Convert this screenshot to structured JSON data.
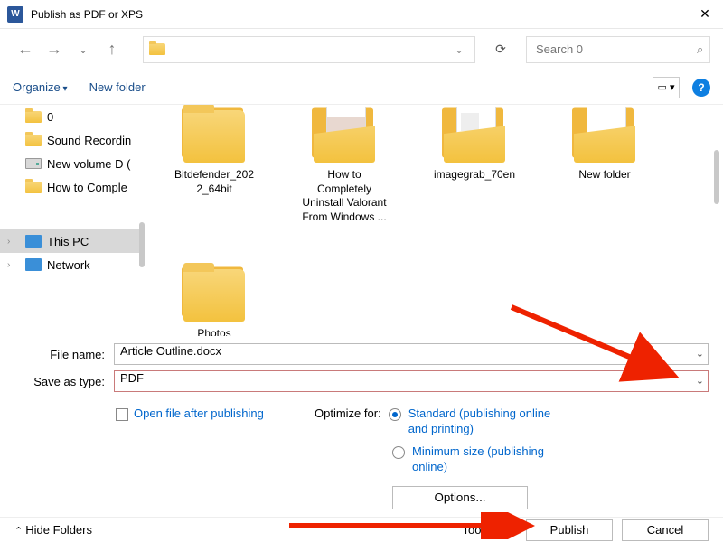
{
  "title": "Publish as PDF or XPS",
  "search": {
    "placeholder": "Search 0"
  },
  "toolbar": {
    "organize": "Organize",
    "new_folder": "New folder"
  },
  "sidebar": {
    "items": [
      {
        "label": "0",
        "icon": "folder"
      },
      {
        "label": "Sound Recordin",
        "icon": "folder"
      },
      {
        "label": "New volume D (",
        "icon": "drive"
      },
      {
        "label": "How to Comple",
        "icon": "folder"
      }
    ],
    "roots": [
      {
        "label": "This PC",
        "icon": "pc",
        "selected": true
      },
      {
        "label": "Network",
        "icon": "net",
        "selected": false
      }
    ]
  },
  "folders": [
    {
      "label": "Bitdefender_2022_64bit",
      "preview": "none"
    },
    {
      "label": "How to Completely Uninstall Valorant From Windows ...",
      "preview": "p1"
    },
    {
      "label": "imagegrab_70en",
      "preview": "p2"
    },
    {
      "label": "New folder",
      "preview": "p3"
    },
    {
      "label": "Photos",
      "preview": "none"
    }
  ],
  "form": {
    "filename_label": "File name:",
    "filename_value": "Article Outline.docx",
    "type_label": "Save as type:",
    "type_value": "PDF",
    "open_after": "Open file after publishing",
    "optimize_label": "Optimize for:",
    "opt_standard": "Standard (publishing online and printing)",
    "opt_minimum": "Minimum size (publishing online)",
    "options_btn": "Options..."
  },
  "footer": {
    "hide": "Hide Folders",
    "tools": "Tools",
    "publish": "Publish",
    "cancel": "Cancel"
  }
}
